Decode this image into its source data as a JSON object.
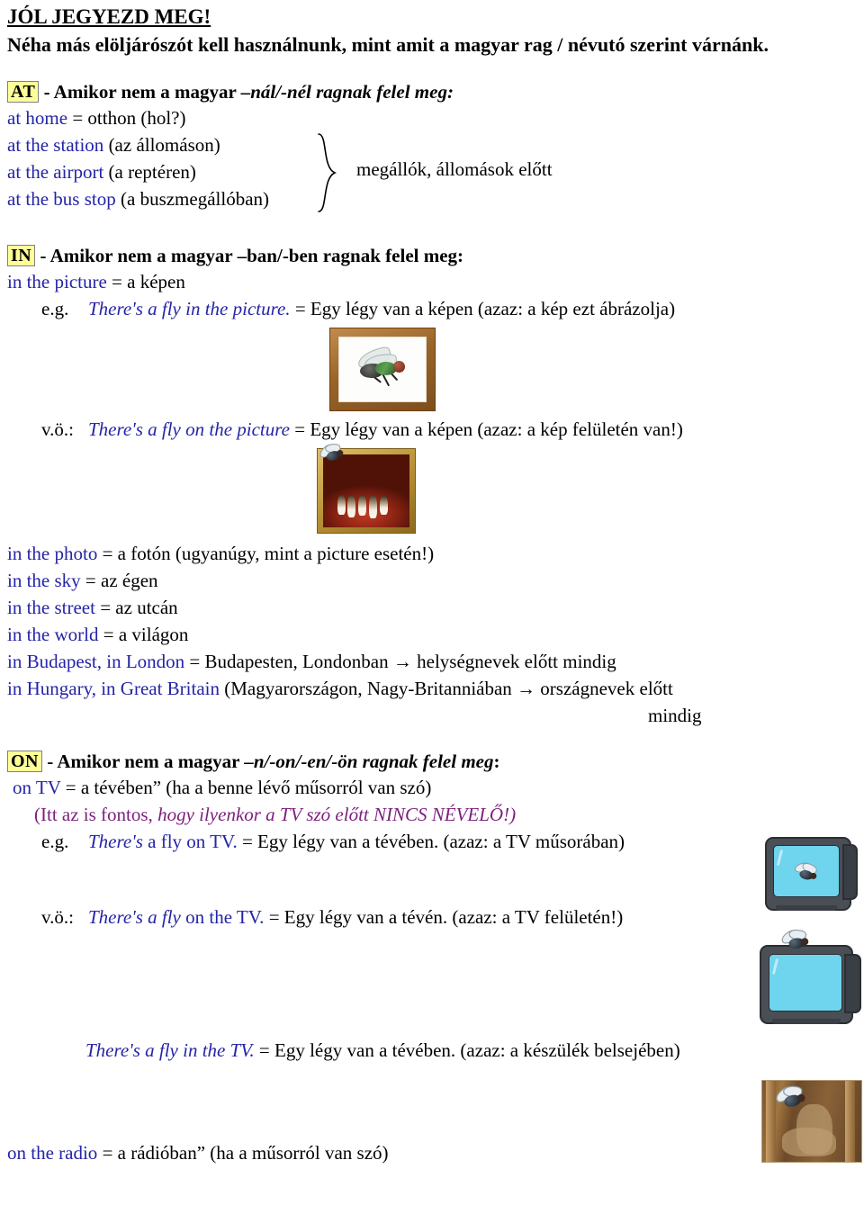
{
  "document": {
    "title": "JÓL JEGYEZD MEG!",
    "subtitle": "Néha más elöljárószót kell használnunk, mint amit a magyar rag / névutó szerint várnánk."
  },
  "colors": {
    "blue": "#2424a8",
    "purple": "#7b1f7b",
    "highlight": "#ffff99",
    "text": "#000000"
  },
  "section_at": {
    "tag": "AT",
    "head_plain": " -  Amikor nem a magyar ",
    "head_italic": "–nál/-nél ragnak felel meg:",
    "lines": [
      {
        "en": "at home",
        "hu": " = otthon (hol?)"
      },
      {
        "en": "at the station",
        "hu": " (az állomáson)"
      },
      {
        "en": "at the airport",
        "hu": " (a reptéren)"
      },
      {
        "en": "at the bus stop",
        "hu": " (a buszmegállóban)"
      }
    ],
    "brace_label": "megállók, állomások előtt"
  },
  "section_in": {
    "tag": "IN",
    "head_plain": " -  Amikor nem a magyar ",
    "head_italic": "–ban/-ben ragnak felel meg:",
    "first_line_en": "in the picture",
    "first_line_hu": " = a képen",
    "eg_label": "e.g.",
    "eg_en": "There's a fly in the picture.",
    "eg_hu": " = Egy légy van a képen (azaz: a kép ezt ábrázolja)",
    "vo_label": "v.ö.:",
    "vo_en": "There's a fly on the picture",
    "vo_hu": " = Egy légy van a képen (azaz: a kép felületén van!)",
    "list": [
      {
        "en": "in the photo",
        "hu": " = a fotón (ugyanúgy, mint a picture esetén!)"
      },
      {
        "en": "in the sky",
        "hu": " = az égen"
      },
      {
        "en": "in the street",
        "hu": " = az utcán"
      },
      {
        "en": "in the world",
        "hu": " = a világon"
      },
      {
        "en": "in Budapest, in London",
        "hu": " = Budapesten, Londonban → helységnevek előtt mindig"
      },
      {
        "en": "in Hungary, in Great Britain",
        "hu": " (Magyarországon, Nagy-Britanniában → országnevek előtt"
      }
    ],
    "list_overflow": "mindig"
  },
  "section_on": {
    "tag": "ON",
    "head_plain": " - Amikor nem a magyar ",
    "head_italic": "–n/-on/-en/-ön ragnak felel meg",
    "head_tail": ":",
    "tv_line_en": "on TV",
    "tv_line_hu": " = a tévében” (ha a benne lévő műsorról van szó)",
    "note_plain": "(Itt az is fontos, ",
    "note_italic": "hogy ilyenkor a TV szó előtt NINCS NÉVELŐ!)",
    "eg_label": "e.g.",
    "eg_en_italic": "There's",
    "eg_en_plain": " a fly on TV.",
    "eg_hu": " = Egy légy van a tévében. (azaz: a TV műsorában)",
    "vo_label": "v.ö.:",
    "vo_en_italic": "There's a fly",
    "vo_en_plain": " on the TV.",
    "vo_hu": " = Egy légy van a tévén. (azaz: a TV felületén!)",
    "in_tv_en": "There's a fly in the TV.",
    "in_tv_hu": " = Egy légy van a tévében. (azaz: a készülék belsejében)",
    "radio_en": "on the radio",
    "radio_hu": " = a rádióban” (ha a műsorról van szó)"
  },
  "images": {
    "fly_in_picture": "framed-picture-of-fly",
    "fly_on_picture": "framed-dark-painting-with-fly-on-surface",
    "fly_on_tv_screen": "television-with-fly-on-screen",
    "fly_on_tv_top": "television-with-fly-on-top",
    "fly_inside_device": "radio-interior-with-fly"
  }
}
